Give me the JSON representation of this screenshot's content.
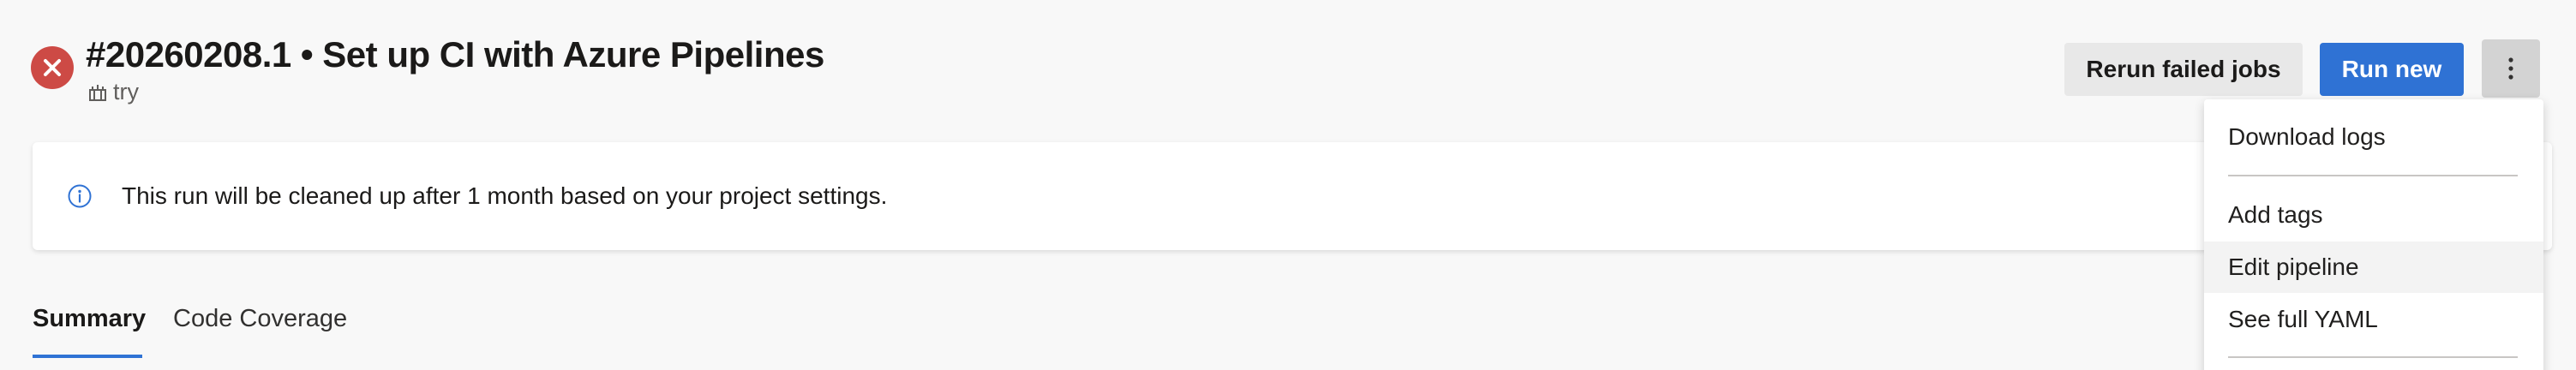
{
  "header": {
    "title": "#20260208.1 • Set up CI with Azure Pipelines",
    "branch": "try",
    "status_icon": "failed-x-icon",
    "status_color": "#cd4a45"
  },
  "actions": {
    "rerun_label": "Rerun failed jobs",
    "run_new_label": "Run new",
    "more_icon": "more-vertical-icon",
    "primary_color": "#2f72d4"
  },
  "banner": {
    "icon": "info-icon",
    "text": "This run will be cleaned up after 1 month based on your project settings."
  },
  "tabs": [
    {
      "label": "Summary",
      "selected": true
    },
    {
      "label": "Code Coverage",
      "selected": false
    }
  ],
  "menu": {
    "items": [
      {
        "label": "Download logs"
      },
      {
        "label": "Add tags"
      },
      {
        "label": "Edit pipeline",
        "hovered": true
      },
      {
        "label": "See full YAML"
      }
    ]
  }
}
